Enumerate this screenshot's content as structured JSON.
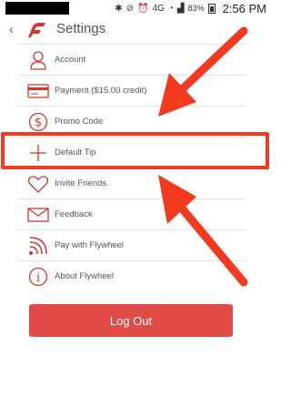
{
  "status_bar": {
    "icons": [
      "bluetooth-icon",
      "mute-icon",
      "alarm-icon",
      "signal-4g-icon",
      "wifi-icon",
      "cell-signal-icon"
    ],
    "network": "4G",
    "battery": "83%",
    "time": "2:56 PM"
  },
  "header": {
    "title": "Settings"
  },
  "menu": {
    "items": [
      {
        "label": "Account",
        "icon": "person-icon"
      },
      {
        "label": "Payment ($15.00 credit)",
        "icon": "credit-card-icon"
      },
      {
        "label": "Promo Code",
        "icon": "dollar-circle-icon"
      },
      {
        "label": "Default Tip",
        "icon": "plus-icon"
      },
      {
        "label": "Invite Friends",
        "icon": "heart-icon"
      },
      {
        "label": "Feedback",
        "icon": "envelope-icon"
      },
      {
        "label": "Pay with Flywheel",
        "icon": "wireless-signal-icon"
      },
      {
        "label": "About Flywheel",
        "icon": "info-circle-icon"
      }
    ]
  },
  "logout": {
    "label": "Log Out"
  },
  "colors": {
    "accent": "#e14b46",
    "annotation": "#f13a1e",
    "icon": "#d9342b"
  }
}
